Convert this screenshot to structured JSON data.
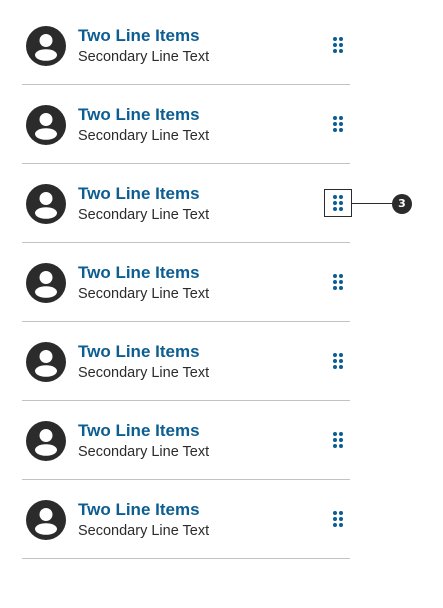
{
  "colors": {
    "primary_text": "#0b5d92",
    "secondary_text": "#2b2b2b",
    "divider": "#c3c3c3",
    "avatar": "#2b2b2b",
    "drag_handle": "#0b5d92",
    "callout": "#2b2b2b"
  },
  "list": {
    "items": [
      {
        "primary": "Two Line Items",
        "secondary": "Secondary Line Text",
        "avatar_icon": "person-icon",
        "handle_icon": "drag-handle-icon"
      },
      {
        "primary": "Two Line Items",
        "secondary": "Secondary Line Text",
        "avatar_icon": "person-icon",
        "handle_icon": "drag-handle-icon"
      },
      {
        "primary": "Two Line Items",
        "secondary": "Secondary Line Text",
        "avatar_icon": "person-icon",
        "handle_icon": "drag-handle-icon",
        "focused": true
      },
      {
        "primary": "Two Line Items",
        "secondary": "Secondary Line Text",
        "avatar_icon": "person-icon",
        "handle_icon": "drag-handle-icon"
      },
      {
        "primary": "Two Line Items",
        "secondary": "Secondary Line Text",
        "avatar_icon": "person-icon",
        "handle_icon": "drag-handle-icon"
      },
      {
        "primary": "Two Line Items",
        "secondary": "Secondary Line Text",
        "avatar_icon": "person-icon",
        "handle_icon": "drag-handle-icon"
      },
      {
        "primary": "Two Line Items",
        "secondary": "Secondary Line Text",
        "avatar_icon": "person-icon",
        "handle_icon": "drag-handle-icon"
      }
    ]
  },
  "callout": {
    "label": "3"
  }
}
